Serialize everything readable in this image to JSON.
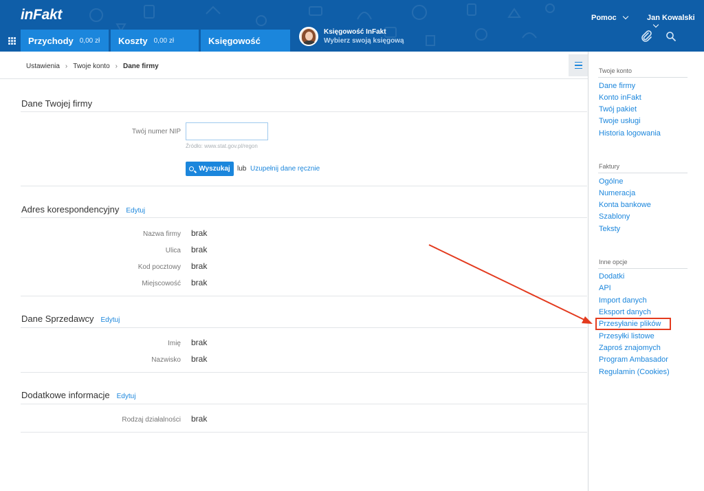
{
  "header": {
    "logo": "inFakt",
    "help_label": "Pomoc",
    "user_name": "Jan Kowalski",
    "tabs": [
      {
        "label": "Przychody",
        "value": "0,00 zł"
      },
      {
        "label": "Koszty",
        "value": "0,00 zł"
      },
      {
        "label": "Księgowość",
        "value": ""
      }
    ],
    "accountant": {
      "name": "Księgowość InFakt",
      "subtitle": "Wybierz swoją księgową"
    },
    "icons": [
      "apps-icon",
      "paperclip-icon",
      "search-icon",
      "chevron-down-icon"
    ]
  },
  "breadcrumb": [
    "Ustawienia",
    "Twoje konto",
    "Dane firmy"
  ],
  "main": {
    "company": {
      "title": "Dane Twojej firmy",
      "nip_label": "Twój numer NIP",
      "nip_value": "",
      "source": "Źródło: www.stat.gov.pl/regon",
      "search_button": "Wyszukaj",
      "or_text": "lub",
      "manual_link": "Uzupełnij dane ręcznie"
    },
    "address": {
      "title": "Adres korespondencyjny",
      "edit": "Edytuj",
      "rows": [
        {
          "label": "Nazwa firmy",
          "value": "brak"
        },
        {
          "label": "Ulica",
          "value": "brak"
        },
        {
          "label": "Kod pocztowy",
          "value": "brak"
        },
        {
          "label": "Miejscowość",
          "value": "brak"
        }
      ]
    },
    "seller": {
      "title": "Dane Sprzedawcy",
      "edit": "Edytuj",
      "rows": [
        {
          "label": "Imię",
          "value": "brak"
        },
        {
          "label": "Nazwisko",
          "value": "brak"
        }
      ]
    },
    "extra": {
      "title": "Dodatkowe informacje",
      "edit": "Edytuj",
      "rows": [
        {
          "label": "Rodzaj działalności",
          "value": "brak"
        }
      ]
    }
  },
  "sidebar": {
    "groups": [
      {
        "heading": "Twoje konto",
        "items": [
          "Dane firmy",
          "Konto inFakt",
          "Twój pakiet",
          "Twoje usługi",
          "Historia logowania"
        ]
      },
      {
        "heading": "Faktury",
        "items": [
          "Ogólne",
          "Numeracja",
          "Konta bankowe",
          "Szablony",
          "Teksty"
        ]
      },
      {
        "heading": "Inne opcje",
        "items": [
          "Dodatki",
          "API",
          "Import danych",
          "Eksport danych",
          "Przesyłanie plików",
          "Przesyłki listowe",
          "Zaproś znajomych",
          "Program Ambasador",
          "Regulamin (Cookies)"
        ]
      }
    ],
    "highlighted_item": "Przesyłanie plików"
  },
  "colors": {
    "header_bg": "#0f5ea8",
    "tab_bg": "#1b86dc",
    "link": "#1b86dc",
    "annotation": "#e33a1e"
  }
}
